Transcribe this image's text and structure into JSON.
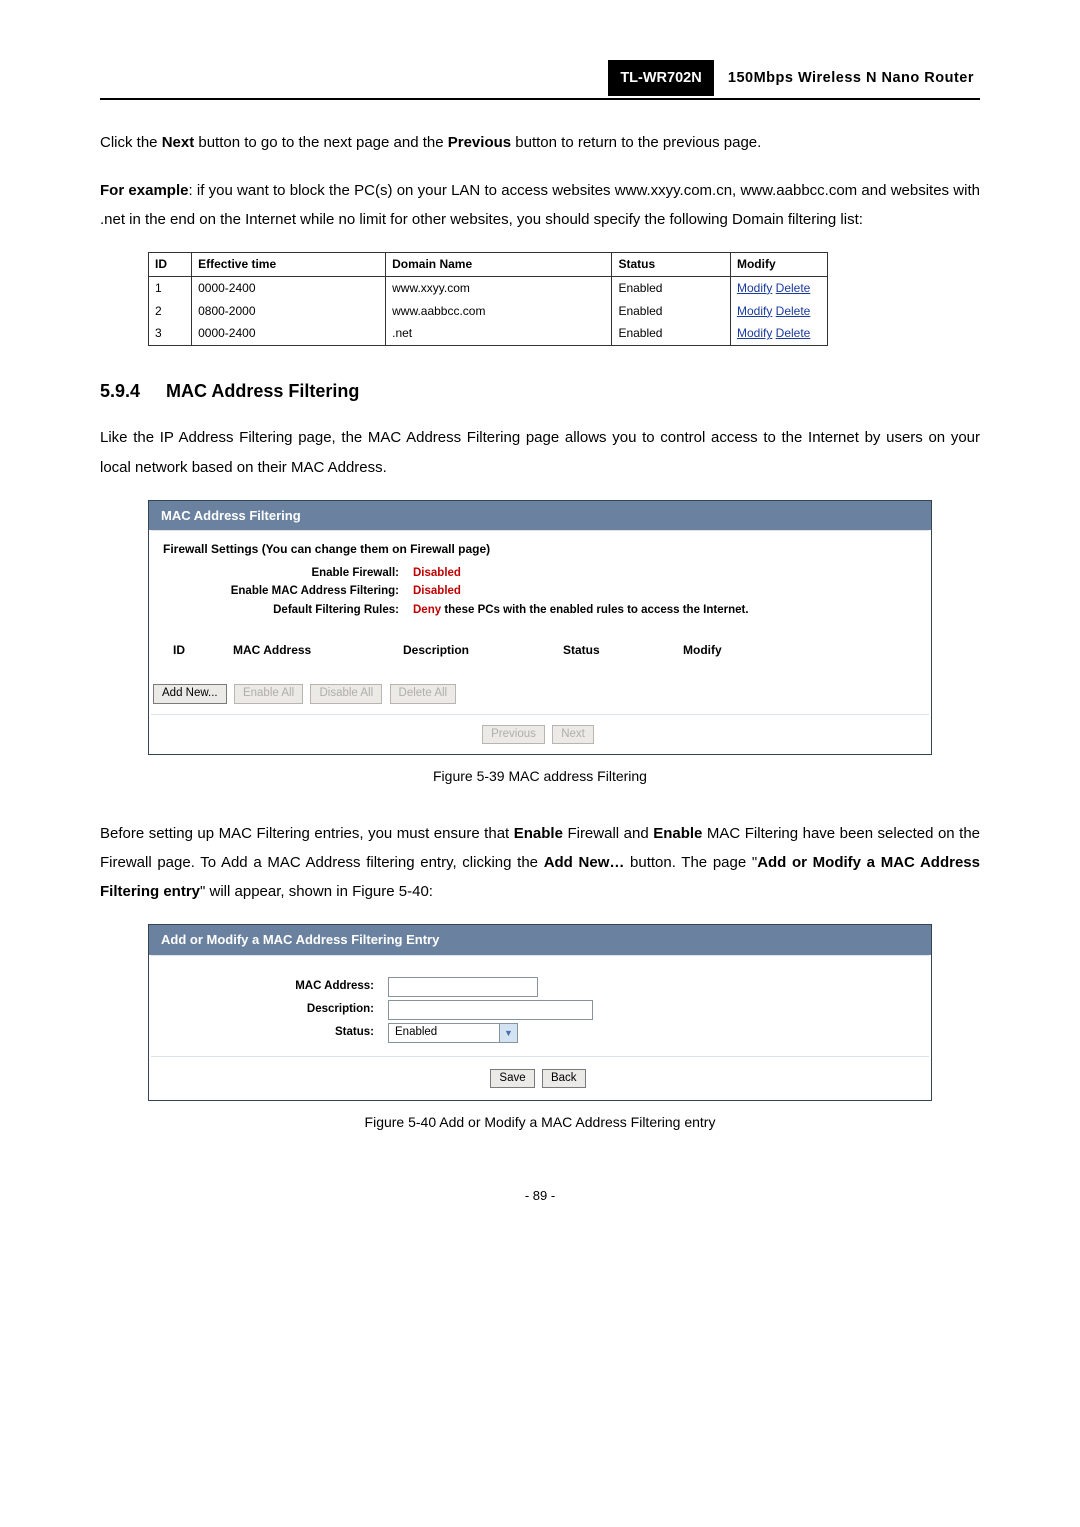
{
  "header": {
    "model": "TL-WR702N",
    "model_desc": "150Mbps  Wireless  N  Nano  Router"
  },
  "para1_pre": "Click the ",
  "para1_b1": "Next",
  "para1_mid": " button to go to the next page and the ",
  "para1_b2": "Previous",
  "para1_post": " button to return to the previous page.",
  "para2_b": "For example",
  "para2_rest": ": if you want to block the PC(s) on your LAN to access websites www.xxyy.com.cn, www.aabbcc.com and websites with .net in the end on the Internet while no limit for other websites, you should specify the following Domain filtering list:",
  "domain_table": {
    "headers": [
      "ID",
      "Effective time",
      "Domain Name",
      "Status",
      "Modify"
    ],
    "rows": [
      {
        "id": "1",
        "time": "0000-2400",
        "domain": "www.xxyy.com",
        "status": "Enabled",
        "modify": "Modify",
        "delete": "Delete"
      },
      {
        "id": "2",
        "time": "0800-2000",
        "domain": "www.aabbcc.com",
        "status": "Enabled",
        "modify": "Modify",
        "delete": "Delete"
      },
      {
        "id": "3",
        "time": "0000-2400",
        "domain": ".net",
        "status": "Enabled",
        "modify": "Modify",
        "delete": "Delete"
      }
    ]
  },
  "section": {
    "num": "5.9.4",
    "title": "MAC Address Filtering"
  },
  "para3": "Like the IP Address Filtering page, the MAC Address Filtering page allows you to control access to the Internet by users on your local network based on their MAC Address.",
  "mac_panel": {
    "title": "MAC Address Filtering",
    "fw_head": "Firewall Settings (You can change them on Firewall page)",
    "rows": {
      "enable_fw_label": "Enable Firewall:",
      "enable_fw_val": "Disabled",
      "enable_mac_label": "Enable MAC Address Filtering:",
      "enable_mac_val": "Disabled",
      "default_rules_label": "Default Filtering Rules:",
      "default_rules_deny": "Deny ",
      "default_rules_rest": "these PCs with the enabled rules to access the Internet."
    },
    "cols": {
      "id": "ID",
      "mac": "MAC Address",
      "desc": "Description",
      "status": "Status",
      "modify": "Modify"
    },
    "buttons": {
      "addnew": "Add New...",
      "enableall": "Enable All",
      "disableall": "Disable All",
      "deleteall": "Delete All",
      "prev": "Previous",
      "next": "Next"
    }
  },
  "caption39": "Figure 5-39 MAC address Filtering",
  "para4_a": "Before setting up MAC Filtering entries, you must ensure that ",
  "para4_b1": "Enable",
  "para4_b": " Firewall and ",
  "para4_b2": "Enable",
  "para4_c": " MAC Filtering have been selected on the Firewall page. To Add a MAC Address filtering entry, clicking the ",
  "para4_b3": "Add New…",
  "para4_d": " button. The page \"",
  "para4_b4": "Add or Modify a MAC Address Filtering entry",
  "para4_e": "\" will appear, shown in Figure 5-40:",
  "add_panel": {
    "title": "Add or Modify a MAC Address Filtering Entry",
    "mac_label": "MAC Address:",
    "desc_label": "Description:",
    "status_label": "Status:",
    "status_value": "Enabled",
    "save": "Save",
    "back": "Back"
  },
  "caption40": "Figure 5-40 Add or Modify a MAC Address Filtering entry",
  "page_num": "- 89 -"
}
